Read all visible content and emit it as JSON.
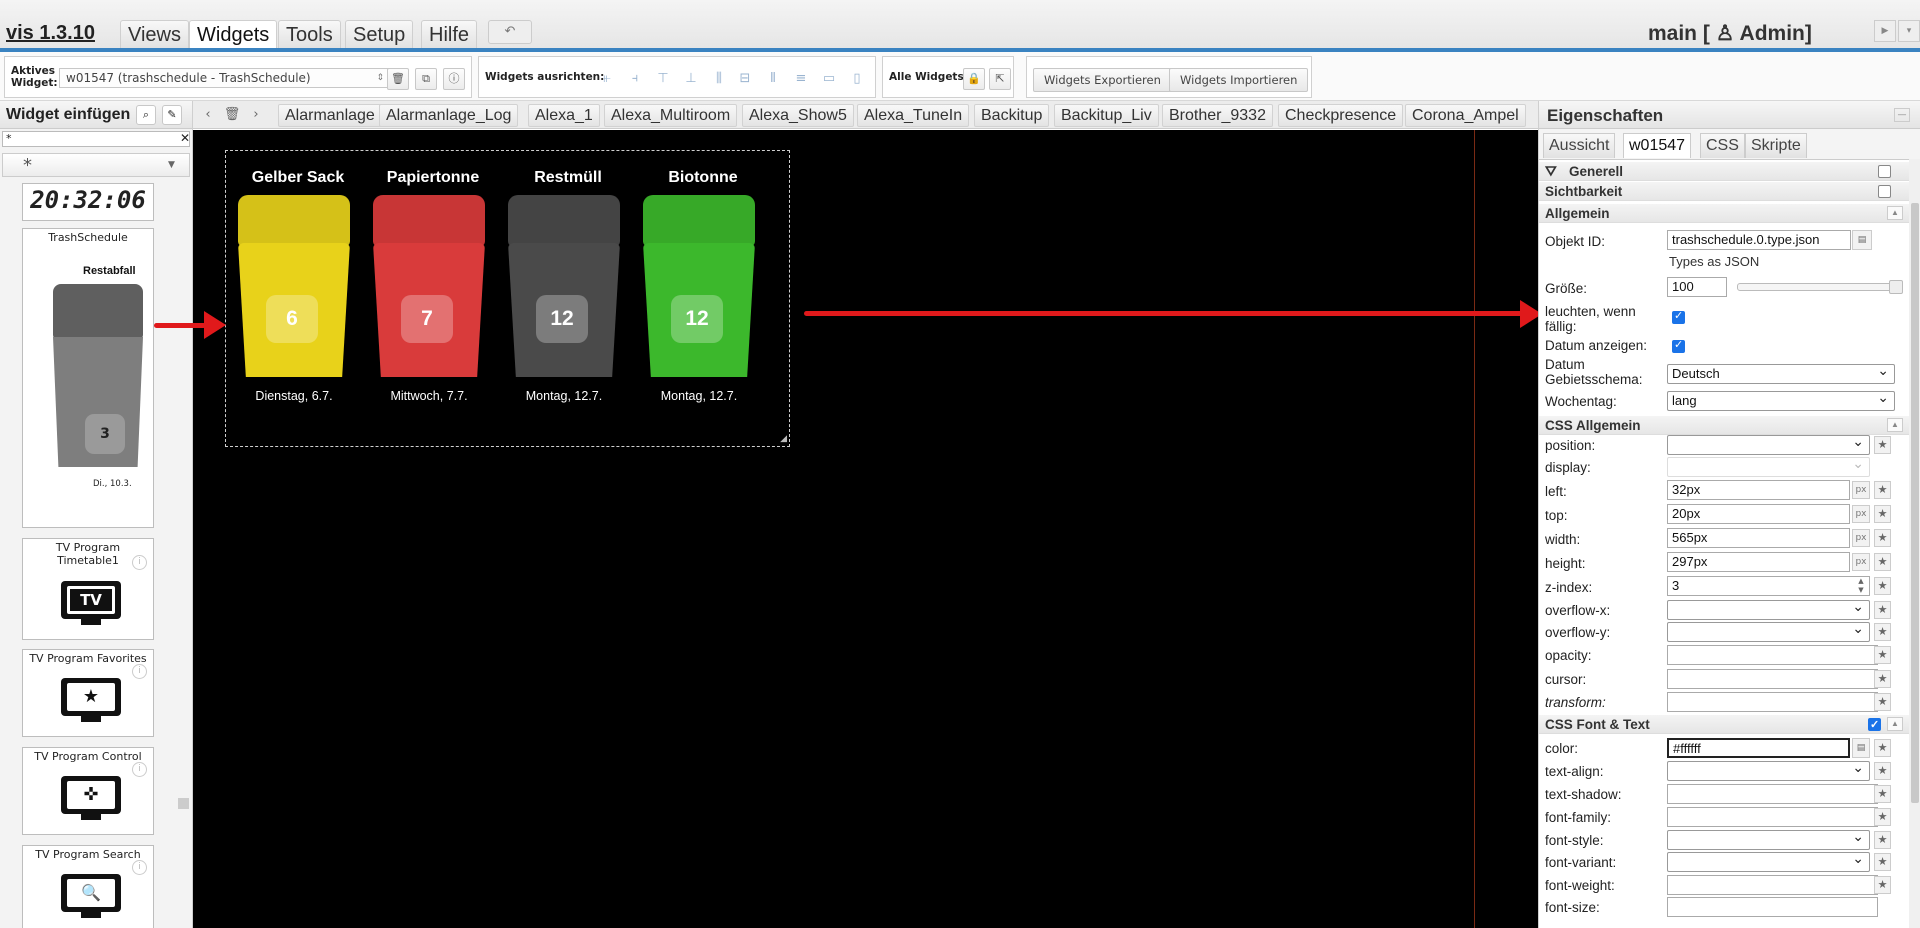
{
  "menubar": {
    "version": "vis 1.3.10",
    "tabs": [
      "Views",
      "Widgets",
      "Tools",
      "Setup",
      "Hilfe"
    ],
    "active_tab": "Widgets",
    "undo": "↶",
    "main_title": "main [ ♙ Admin]"
  },
  "toolbar": {
    "active_widget_label": "Aktives Widget:",
    "active_widget_value": "w01547 (trashschedule - TrashSchedule)",
    "align_label": "Widgets ausrichten:",
    "all_widgets_label": "Alle Widgets:",
    "export_label": "Widgets Exportieren",
    "import_label": "Widgets Importieren"
  },
  "widget_panel": {
    "title": "Widget einfügen",
    "filter_value": "*",
    "set_value": "*",
    "clock_text": "20:32:06",
    "cards": [
      {
        "label": "TrashSchedule",
        "preview_name": "Restabfall",
        "preview_count": "3",
        "preview_date": "Di., 10.3."
      },
      {
        "label": "TV Program Timetable1",
        "icon_text": "TV"
      },
      {
        "label": "TV Program Favorites",
        "icon_text": "★"
      },
      {
        "label": "TV Program Control",
        "icon_text": "✜"
      },
      {
        "label": "TV Program Search",
        "icon_text": "🔍"
      }
    ]
  },
  "view_tabs": [
    "Alarmanlage",
    "Alarmanlage_Log",
    "Alexa_1",
    "Alexa_Multiroom",
    "Alexa_Show5",
    "Alexa_TuneIn",
    "Backitup",
    "Backitup_Liv",
    "Brother_9332",
    "Checkpresence",
    "Corona_Ampel"
  ],
  "trash_widget": {
    "bins": [
      {
        "name": "Gelber Sack",
        "count": "6",
        "date": "Dienstag, 6.7.",
        "color": "#e8d21a"
      },
      {
        "name": "Papiertonne",
        "count": "7",
        "date": "Mittwoch, 7.7.",
        "color": "#d93b3b"
      },
      {
        "name": "Restmüll",
        "count": "12",
        "date": "Montag, 12.7.",
        "color": "#4a4a4a"
      },
      {
        "name": "Biotonne",
        "count": "12",
        "date": "Montag, 12.7.",
        "color": "#3cb82c"
      }
    ]
  },
  "properties": {
    "title": "Eigenschaften",
    "tabs": [
      "Aussicht",
      "w01547",
      "CSS",
      "Skripte"
    ],
    "active_tab": "w01547",
    "sections": {
      "generell": "Generell",
      "sichtbarkeit": "Sichtbarkeit",
      "allgemein": "Allgemein",
      "css_allgemein": "CSS Allgemein",
      "css_font": "CSS Font & Text"
    },
    "allgemein": {
      "objekt_id_label": "Objekt ID:",
      "objekt_id_value": "trashschedule.0.type.json",
      "objekt_id_note": "Types as JSON",
      "groesse_label": "Größe:",
      "groesse_value": "100",
      "groesse_slider_fraction": 1.0,
      "leuchten_label": "leuchten, wenn fällig:",
      "leuchten_checked": true,
      "datum_label": "Datum anzeigen:",
      "datum_checked": true,
      "schema_label": "Datum Gebietsschema:",
      "schema_value": "Deutsch",
      "wochentag_label": "Wochentag:",
      "wochentag_value": "lang"
    },
    "css_allgemein": {
      "position_label": "position:",
      "display_label": "display:",
      "left_label": "left:",
      "left_value": "32px",
      "top_label": "top:",
      "top_value": "20px",
      "width_label": "width:",
      "width_value": "565px",
      "height_label": "height:",
      "height_value": "297px",
      "zindex_label": "z-index:",
      "zindex_value": "3",
      "overflowx_label": "overflow-x:",
      "overflowy_label": "overflow-y:",
      "opacity_label": "opacity:",
      "cursor_label": "cursor:",
      "transform_label": "transform:"
    },
    "css_font": {
      "color_label": "color:",
      "color_value": "#ffffff",
      "textalign_label": "text-align:",
      "textshadow_label": "text-shadow:",
      "fontfamily_label": "font-family:",
      "fontstyle_label": "font-style:",
      "fontvariant_label": "font-variant:",
      "fontweight_label": "font-weight:",
      "fontsize_label": "font-size:"
    },
    "px_unit": "px"
  }
}
